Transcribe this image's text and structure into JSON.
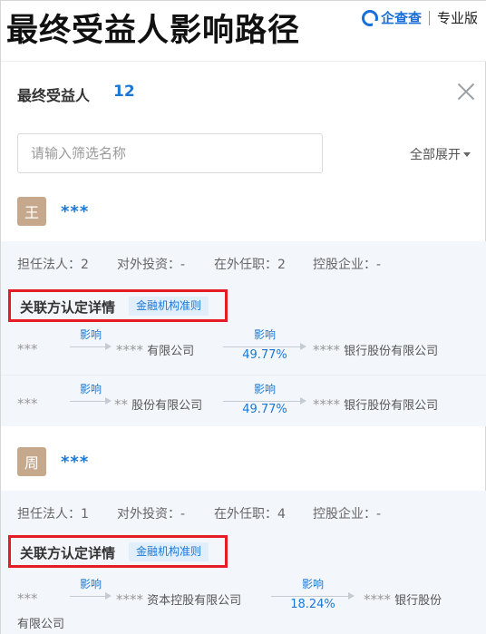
{
  "hero": {
    "title": "最终受益人影响路径",
    "brand_name": "企查查",
    "brand_tag": "专业版"
  },
  "panel": {
    "title": "最终受益人",
    "count": "12",
    "close_icon": "close-icon"
  },
  "filter": {
    "placeholder": "请输入筛选名称",
    "value": "",
    "expand_label": "全部展开"
  },
  "colors": {
    "accent": "#1a78d4",
    "highlight_border": "#e51c23",
    "stats_bg": "#f3f7fc",
    "avatar_bg": "#c6a98c"
  },
  "persons": [
    {
      "avatar": "王",
      "name": "***",
      "stats": [
        "担任法人：2",
        "对外投资：-",
        "在外任职：2",
        "控股企业：-"
      ],
      "rel_title": "关联方认定详情",
      "rel_tag": "金融机构准则",
      "paths": [
        {
          "n1": "***",
          "e1": "影响",
          "n2_stars": "****",
          "n2_text": "有限公司",
          "e2": "影响",
          "e2_pct": "49.77%",
          "n3_stars": "****",
          "n3_text": "银行股份有限公司"
        },
        {
          "n1": "***",
          "e1": "影响",
          "n2_stars": "**",
          "n2_text": "股份有限公司",
          "e2": "影响",
          "e2_pct": "49.77%",
          "n3_stars": "****",
          "n3_text": "银行股份有限公司"
        }
      ]
    },
    {
      "avatar": "周",
      "name": "***",
      "stats": [
        "担任法人：1",
        "对外投资：-",
        "在外任职：4",
        "控股企业：-"
      ],
      "rel_title": "关联方认定详情",
      "rel_tag": "金融机构准则",
      "paths": [
        {
          "n1": "***",
          "e1": "影响",
          "n2_stars": "****",
          "n2_text": "资本控股有限公司",
          "e2": "影响",
          "e2_pct": "18.24%",
          "n3_stars": "****",
          "n3_text": "银行股份",
          "n3_wrap": "有限公司"
        }
      ]
    }
  ]
}
